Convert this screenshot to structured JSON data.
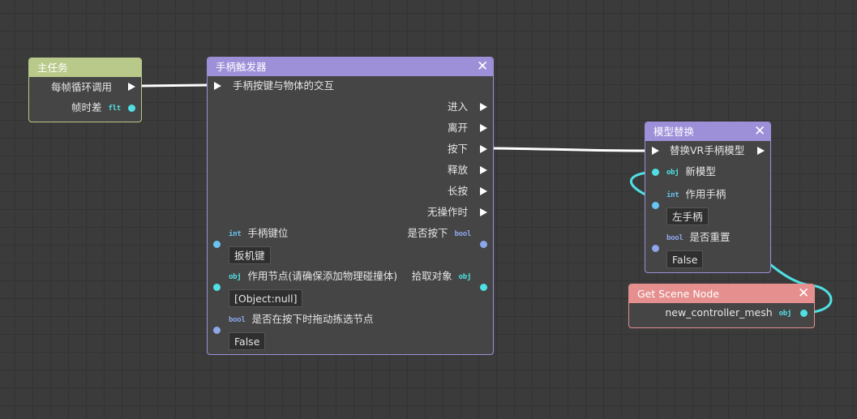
{
  "colors": {
    "canvas": "#3b3b3b",
    "main_task_header": "#b8c98a",
    "trigger_header": "#9d8fd8",
    "replace_header": "#9d8fd8",
    "scene_header": "#e58f8f",
    "wire_exec": "#ffffff",
    "wire_obj": "#4fe0e3"
  },
  "main_task": {
    "title": "主任务",
    "exec_out": "每帧循环调用",
    "delta_label": "帧时差",
    "delta_type": "flt"
  },
  "trigger": {
    "title": "手柄触发器",
    "exec_in": "手柄按键与物体的交互",
    "outputs": [
      "进入",
      "离开",
      "按下",
      "释放",
      "长按",
      "无操作时"
    ],
    "button_type": "int",
    "button_label": "手柄键位",
    "button_value": "扳机键",
    "pressed_label": "是否按下",
    "pressed_type": "bool",
    "node_type": "obj",
    "node_label": "作用节点(请确保添加物理碰撞体)",
    "node_value": "[Object:null]",
    "picked_label": "拾取对象",
    "picked_type": "obj",
    "drag_type": "bool",
    "drag_label": "是否在按下时拖动拣选节点",
    "drag_value": "False"
  },
  "replace": {
    "title": "模型替换",
    "exec_in": "替换VR手柄模型",
    "model_type": "obj",
    "model_label": "新模型",
    "hand_type": "int",
    "hand_label": "作用手柄",
    "hand_value": "左手柄",
    "reset_type": "bool",
    "reset_label": "是否重置",
    "reset_value": "False"
  },
  "scene_node": {
    "title": "Get Scene Node",
    "output_label": "new_controller_mesh",
    "output_type": "obj"
  }
}
